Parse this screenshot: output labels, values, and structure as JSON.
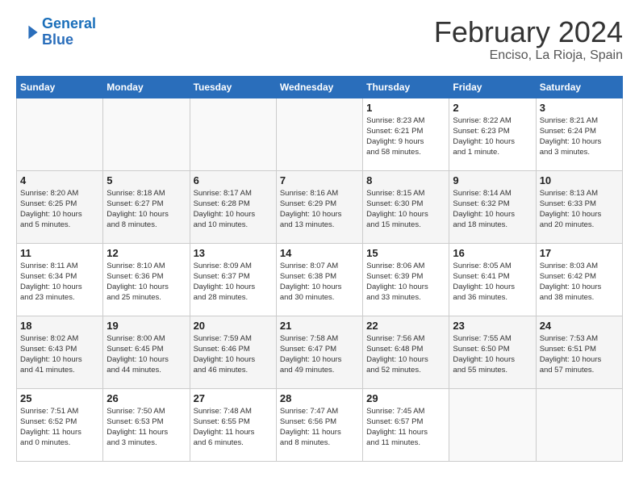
{
  "header": {
    "logo_line1": "General",
    "logo_line2": "Blue",
    "month_title": "February 2024",
    "location": "Enciso, La Rioja, Spain"
  },
  "weekdays": [
    "Sunday",
    "Monday",
    "Tuesday",
    "Wednesday",
    "Thursday",
    "Friday",
    "Saturday"
  ],
  "weeks": [
    [
      {
        "day": "",
        "info": ""
      },
      {
        "day": "",
        "info": ""
      },
      {
        "day": "",
        "info": ""
      },
      {
        "day": "",
        "info": ""
      },
      {
        "day": "1",
        "info": "Sunrise: 8:23 AM\nSunset: 6:21 PM\nDaylight: 9 hours\nand 58 minutes."
      },
      {
        "day": "2",
        "info": "Sunrise: 8:22 AM\nSunset: 6:23 PM\nDaylight: 10 hours\nand 1 minute."
      },
      {
        "day": "3",
        "info": "Sunrise: 8:21 AM\nSunset: 6:24 PM\nDaylight: 10 hours\nand 3 minutes."
      }
    ],
    [
      {
        "day": "4",
        "info": "Sunrise: 8:20 AM\nSunset: 6:25 PM\nDaylight: 10 hours\nand 5 minutes."
      },
      {
        "day": "5",
        "info": "Sunrise: 8:18 AM\nSunset: 6:27 PM\nDaylight: 10 hours\nand 8 minutes."
      },
      {
        "day": "6",
        "info": "Sunrise: 8:17 AM\nSunset: 6:28 PM\nDaylight: 10 hours\nand 10 minutes."
      },
      {
        "day": "7",
        "info": "Sunrise: 8:16 AM\nSunset: 6:29 PM\nDaylight: 10 hours\nand 13 minutes."
      },
      {
        "day": "8",
        "info": "Sunrise: 8:15 AM\nSunset: 6:30 PM\nDaylight: 10 hours\nand 15 minutes."
      },
      {
        "day": "9",
        "info": "Sunrise: 8:14 AM\nSunset: 6:32 PM\nDaylight: 10 hours\nand 18 minutes."
      },
      {
        "day": "10",
        "info": "Sunrise: 8:13 AM\nSunset: 6:33 PM\nDaylight: 10 hours\nand 20 minutes."
      }
    ],
    [
      {
        "day": "11",
        "info": "Sunrise: 8:11 AM\nSunset: 6:34 PM\nDaylight: 10 hours\nand 23 minutes."
      },
      {
        "day": "12",
        "info": "Sunrise: 8:10 AM\nSunset: 6:36 PM\nDaylight: 10 hours\nand 25 minutes."
      },
      {
        "day": "13",
        "info": "Sunrise: 8:09 AM\nSunset: 6:37 PM\nDaylight: 10 hours\nand 28 minutes."
      },
      {
        "day": "14",
        "info": "Sunrise: 8:07 AM\nSunset: 6:38 PM\nDaylight: 10 hours\nand 30 minutes."
      },
      {
        "day": "15",
        "info": "Sunrise: 8:06 AM\nSunset: 6:39 PM\nDaylight: 10 hours\nand 33 minutes."
      },
      {
        "day": "16",
        "info": "Sunrise: 8:05 AM\nSunset: 6:41 PM\nDaylight: 10 hours\nand 36 minutes."
      },
      {
        "day": "17",
        "info": "Sunrise: 8:03 AM\nSunset: 6:42 PM\nDaylight: 10 hours\nand 38 minutes."
      }
    ],
    [
      {
        "day": "18",
        "info": "Sunrise: 8:02 AM\nSunset: 6:43 PM\nDaylight: 10 hours\nand 41 minutes."
      },
      {
        "day": "19",
        "info": "Sunrise: 8:00 AM\nSunset: 6:45 PM\nDaylight: 10 hours\nand 44 minutes."
      },
      {
        "day": "20",
        "info": "Sunrise: 7:59 AM\nSunset: 6:46 PM\nDaylight: 10 hours\nand 46 minutes."
      },
      {
        "day": "21",
        "info": "Sunrise: 7:58 AM\nSunset: 6:47 PM\nDaylight: 10 hours\nand 49 minutes."
      },
      {
        "day": "22",
        "info": "Sunrise: 7:56 AM\nSunset: 6:48 PM\nDaylight: 10 hours\nand 52 minutes."
      },
      {
        "day": "23",
        "info": "Sunrise: 7:55 AM\nSunset: 6:50 PM\nDaylight: 10 hours\nand 55 minutes."
      },
      {
        "day": "24",
        "info": "Sunrise: 7:53 AM\nSunset: 6:51 PM\nDaylight: 10 hours\nand 57 minutes."
      }
    ],
    [
      {
        "day": "25",
        "info": "Sunrise: 7:51 AM\nSunset: 6:52 PM\nDaylight: 11 hours\nand 0 minutes."
      },
      {
        "day": "26",
        "info": "Sunrise: 7:50 AM\nSunset: 6:53 PM\nDaylight: 11 hours\nand 3 minutes."
      },
      {
        "day": "27",
        "info": "Sunrise: 7:48 AM\nSunset: 6:55 PM\nDaylight: 11 hours\nand 6 minutes."
      },
      {
        "day": "28",
        "info": "Sunrise: 7:47 AM\nSunset: 6:56 PM\nDaylight: 11 hours\nand 8 minutes."
      },
      {
        "day": "29",
        "info": "Sunrise: 7:45 AM\nSunset: 6:57 PM\nDaylight: 11 hours\nand 11 minutes."
      },
      {
        "day": "",
        "info": ""
      },
      {
        "day": "",
        "info": ""
      }
    ]
  ]
}
